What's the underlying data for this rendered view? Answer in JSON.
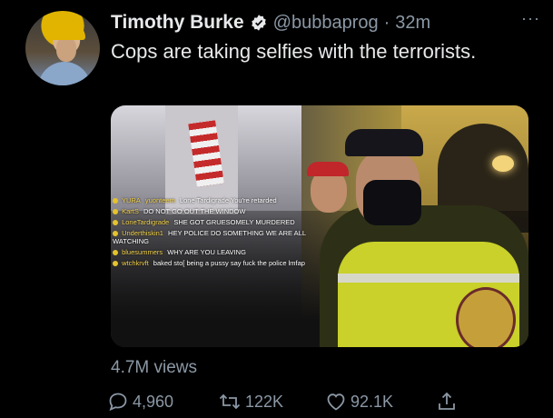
{
  "tweet": {
    "author_name": "Timothy Burke",
    "handle": "@bubbaprog",
    "separator": "·",
    "time": "32m",
    "more": "···",
    "text": "Cops are taking selfies with the terrorists.",
    "views": "4.7M views"
  },
  "media": {
    "chat": [
      {
        "user": "YURA",
        "text": "yuonteem",
        "rest": "Lone Tardigrade You're retarded"
      },
      {
        "user": "KartS",
        "text": "DO NOT GO OUT THE WINDOW"
      },
      {
        "user": "LoneTardigrade",
        "text": "SHE GOT GRUESOMELY MURDERED"
      },
      {
        "user": "Underthiskin1",
        "text": "HEY POLICE DO SOMETHING WE ARE ALL WATCHING"
      },
      {
        "user": "bluesummers",
        "text": "WHY ARE YOU LEAVING"
      },
      {
        "user": "wtchkrvft",
        "text": "baked sto[ being a pussy say fuck the police lmfap"
      }
    ]
  },
  "actions": {
    "reply_count": "4,960",
    "retweet_count": "122K",
    "like_count": "92.1K"
  },
  "colors": {
    "background": "#000000",
    "text_primary": "#e7e9ea",
    "text_secondary": "#8b98a5",
    "verified": "#e7e9ea"
  }
}
